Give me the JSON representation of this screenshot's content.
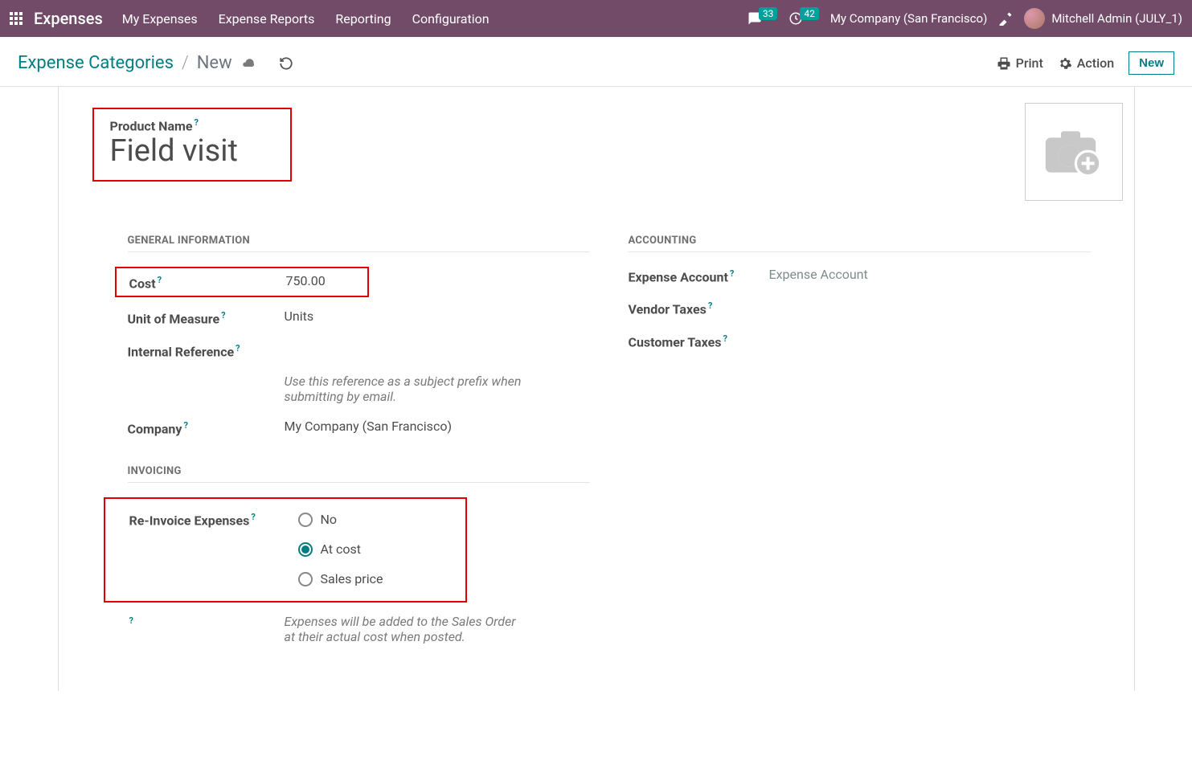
{
  "navbar": {
    "brand": "Expenses",
    "links": [
      "My Expenses",
      "Expense Reports",
      "Reporting",
      "Configuration"
    ],
    "messages_count": "33",
    "activities_count": "42",
    "company": "My Company (San Francisco)",
    "user": "Mitchell Admin (JULY_1)"
  },
  "breadcrumb": {
    "root": "Expense Categories",
    "sep": "/",
    "current": "New"
  },
  "control_panel": {
    "print": "Print",
    "action": "Action",
    "new": "New"
  },
  "form": {
    "product_name_label": "Product Name",
    "product_name_value": "Field visit",
    "sections": {
      "general": "GENERAL INFORMATION",
      "accounting": "ACCOUNTING",
      "invoicing": "INVOICING"
    },
    "cost_label": "Cost",
    "cost_value": "750.00",
    "uom_label": "Unit of Measure",
    "uom_value": "Units",
    "internal_ref_label": "Internal Reference",
    "internal_ref_help": "Use this reference as a subject prefix when submitting by email.",
    "company_label": "Company",
    "company_value": "My Company (San Francisco)",
    "expense_account_label": "Expense Account",
    "expense_account_placeholder": "Expense Account",
    "vendor_taxes_label": "Vendor Taxes",
    "customer_taxes_label": "Customer Taxes",
    "reinvoice_label": "Re-Invoice Expenses",
    "reinvoice_options": {
      "no": "No",
      "at_cost": "At cost",
      "sales_price": "Sales price"
    },
    "reinvoice_help": "Expenses will be added to the Sales Order at their actual cost when posted.",
    "help_marker": "?"
  }
}
